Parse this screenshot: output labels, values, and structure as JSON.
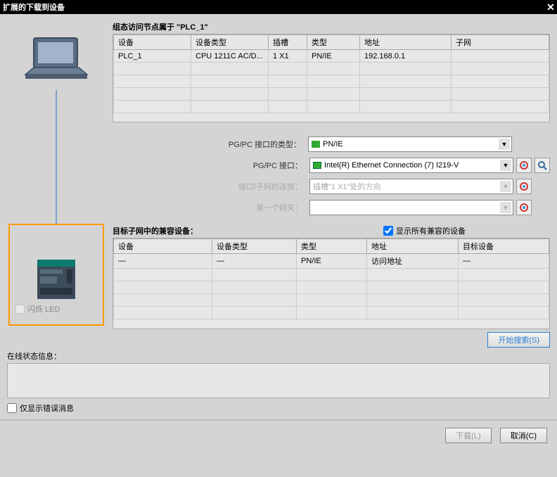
{
  "titlebar": {
    "title": "扩展的下载到设备",
    "close": "✕"
  },
  "config_title": "组态访问节点属于 \"PLC_1\"",
  "grid1": {
    "headers": [
      "设备",
      "设备类型",
      "插槽",
      "类型",
      "地址",
      "子网"
    ],
    "row": {
      "device": "PLC_1",
      "type": "CPU 1211C AC/D...",
      "slot": "1 X1",
      "ptype": "PN/IE",
      "addr": "192.168.0.1",
      "subnet": ""
    }
  },
  "form": {
    "pgtype_lbl": "PG/PC 接口的类型：",
    "pgtype_val": "PN/IE",
    "pgif_lbl": "PG/PC 接口：",
    "pgif_val": "Intel(R) Ethernet Connection (7) I219-V",
    "conn_lbl": "接口/子网的连接：",
    "conn_val": "插槽\"1 X1\"处的方向",
    "gw_lbl": "第一个网关：",
    "gw_val": ""
  },
  "compat": {
    "title": "目标子网中的兼容设备：",
    "chk": "显示所有兼容的设备"
  },
  "grid2": {
    "headers": [
      "设备",
      "设备类型",
      "类型",
      "地址",
      "目标设备"
    ],
    "row": {
      "device": "—",
      "type": "—",
      "ptype": "PN/IE",
      "addr": "访问地址",
      "target": "—"
    }
  },
  "led": "闪烁 LED",
  "search_btn": "开始搜索(S)",
  "status_lbl": "在线状态信息：",
  "errchk": "仅显示错误消息",
  "download_btn": "下载(L)",
  "cancel_btn": "取消(C)",
  "arrow": "▼"
}
